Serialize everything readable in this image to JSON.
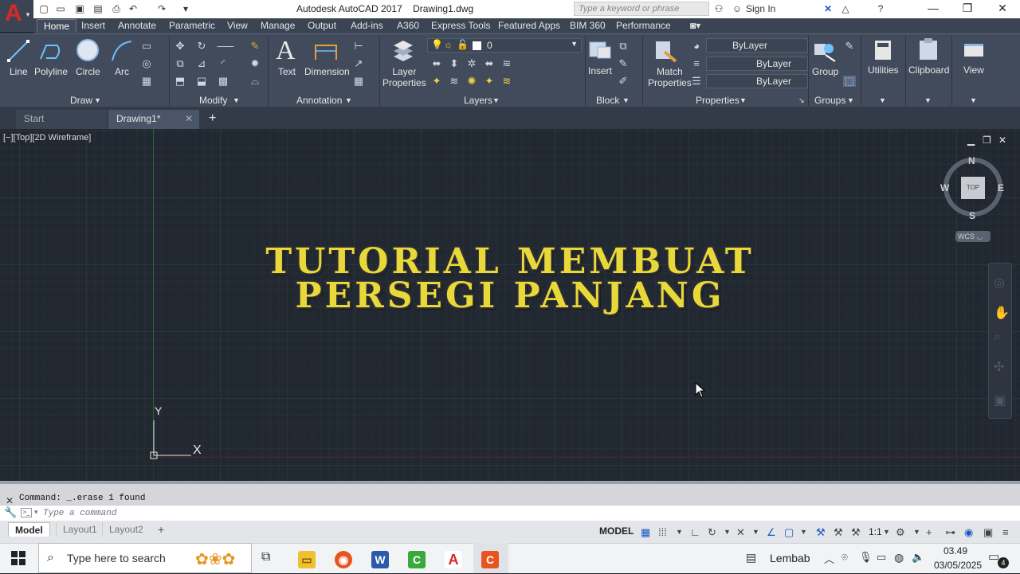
{
  "titlebar": {
    "app_title": "Autodesk AutoCAD 2017    Drawing1.dwg",
    "search_placeholder": "Type a keyword or phrase",
    "signin": "Sign In"
  },
  "ribbon_tabs": [
    "Home",
    "Insert",
    "Annotate",
    "Parametric",
    "View",
    "Manage",
    "Output",
    "Add-ins",
    "A360",
    "Express Tools",
    "Featured Apps",
    "BIM 360",
    "Performance"
  ],
  "draw_panel": {
    "tools": [
      "Line",
      "Polyline",
      "Circle",
      "Arc"
    ],
    "title": "Draw"
  },
  "modify_panel": {
    "title": "Modify"
  },
  "annotation_panel": {
    "tools": [
      "Text",
      "Dimension"
    ],
    "title": "Annotation"
  },
  "layers_panel": {
    "tool": "Layer\nProperties",
    "current_layer": "0",
    "title": "Layers"
  },
  "block_panel": {
    "tool": "Insert",
    "title": "Block"
  },
  "properties_panel": {
    "tool": "Match\nProperties",
    "color": "ByLayer",
    "linetype": "ByLayer",
    "lineweight": "ByLayer",
    "title": "Properties"
  },
  "groups_panel": {
    "tool": "Group",
    "title": "Groups"
  },
  "utilities": {
    "label": "Utilities"
  },
  "clipboard": {
    "label": "Clipboard"
  },
  "view": {
    "label": "View"
  },
  "file_tabs": [
    "Start",
    "Drawing1*"
  ],
  "viewport": {
    "label": "[−][Top][2D Wireframe]",
    "heading_line1": "TUTORIAL MEMBUAT",
    "heading_line2": "PERSEGI PANJANG",
    "viewcube": {
      "n": "N",
      "s": "S",
      "e": "E",
      "w": "W",
      "face": "TOP",
      "wcs": "WCS"
    },
    "ucs": {
      "y": "Y",
      "x": "X"
    }
  },
  "command": {
    "history": "Command: _.erase 1 found",
    "placeholder": "Type a command"
  },
  "layout_tabs": [
    "Model",
    "Layout1",
    "Layout2"
  ],
  "status": {
    "model": "MODEL",
    "scale": "1:1"
  },
  "taskbar": {
    "search_placeholder": "Type here to search",
    "weather": "Lembab",
    "time": "03.49",
    "date": "03/05/2025",
    "notifications": "4"
  },
  "colors": {
    "heading": "#e9d83a",
    "ribbon_bg": "#414b5b",
    "drawing_bg": "#212830",
    "autocad_red": "#d42a2a"
  }
}
